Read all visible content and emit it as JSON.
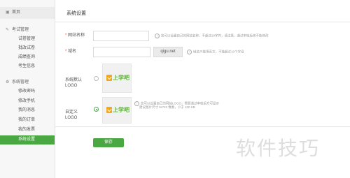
{
  "sidebar": {
    "home": "首页",
    "group1": "考试管理",
    "group1_items": [
      "试卷管理",
      "批改试卷",
      "成绩查询",
      "考生信息"
    ],
    "group2": "系统管理",
    "group2_items": [
      "修改密码",
      "修改手机",
      "我的消息",
      "我的订单",
      "我的发票",
      "系统设置"
    ]
  },
  "page": {
    "title": "系统设置"
  },
  "form": {
    "site_name_label": "网站名称",
    "site_name_value": "",
    "site_name_tip": "您可以设置自己的网站名称，不超过20字符，请注意，通过审核后将不能修改",
    "domain_label": "域名",
    "domain_value": "",
    "domain_suffix": "qigu.net",
    "domain_tip": "域名只能填英文，不能超过10个字母",
    "default_logo_label": "系统默认LOGO",
    "default_logo_text": "上学吧",
    "custom_logo_label": "自定义LOGO",
    "custom_logo_text": "上学吧",
    "custom_logo_tip_line1": "您可以设置自己的网站LOGO，需要通过审核后方可显示",
    "custom_logo_tip_line2": "建议图片尺寸 94*23 像素，小于 100 KB",
    "save_label": "保存"
  },
  "watermark": "软件技巧"
}
